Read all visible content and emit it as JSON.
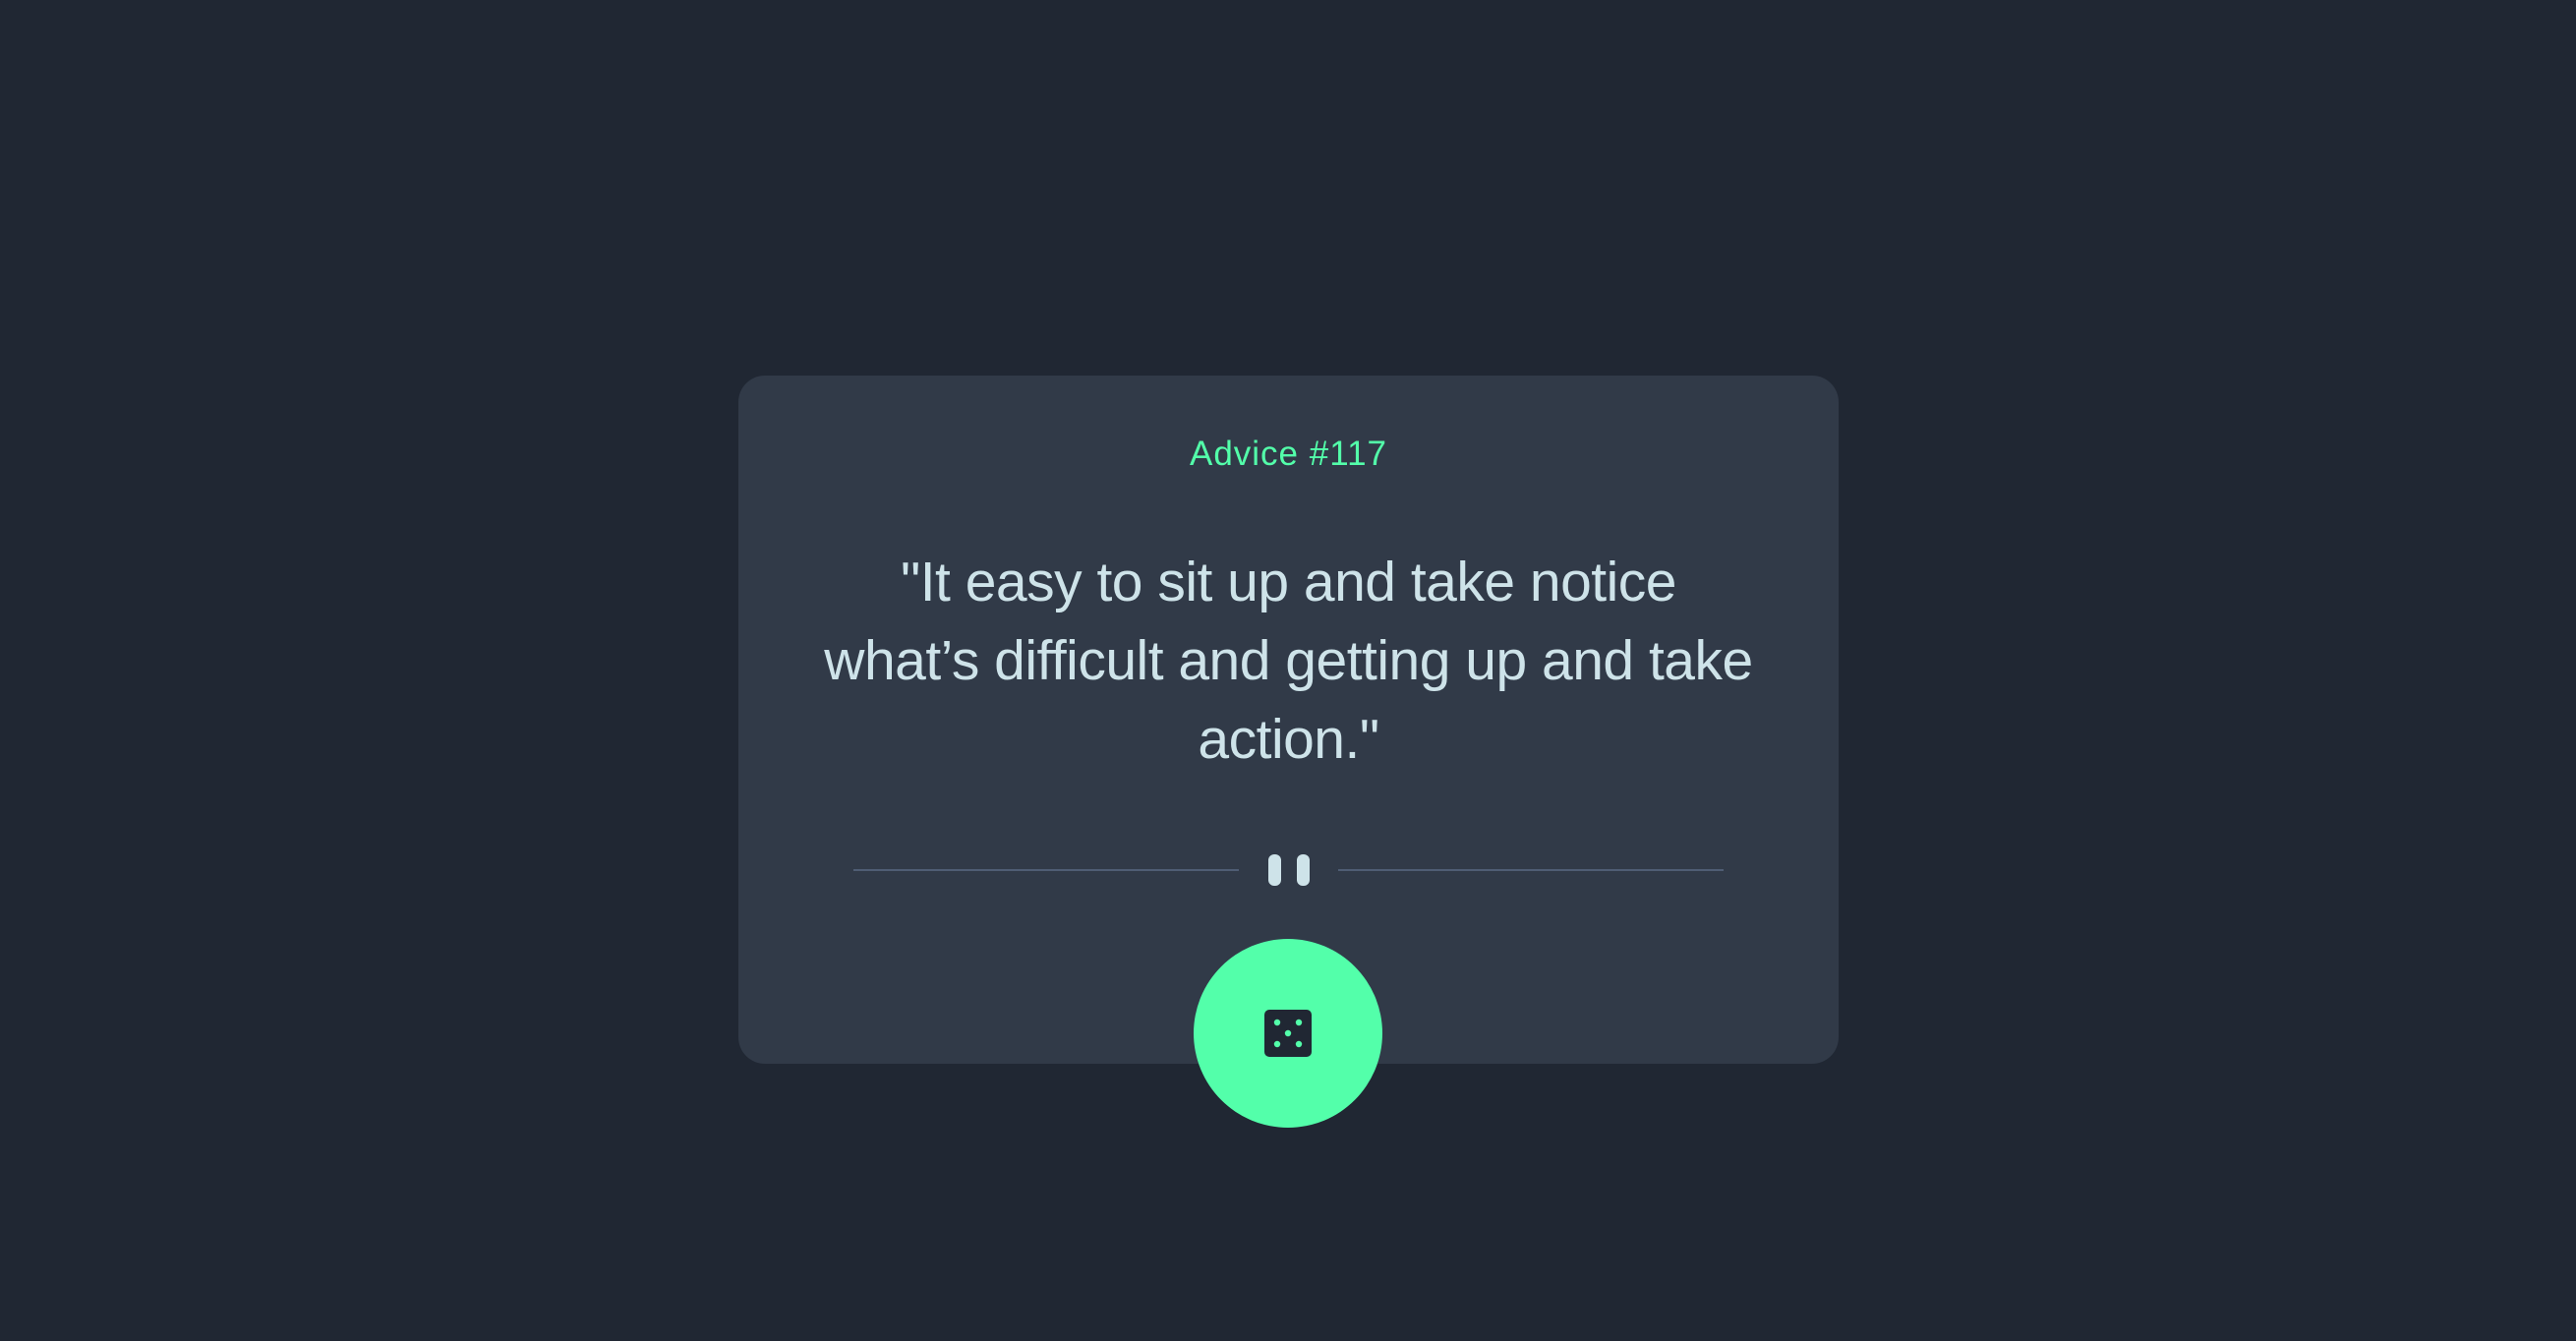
{
  "advice": {
    "label": "Advice #117",
    "text": "\"It easy to sit up and take notice what’s difficult and getting up and take action.\""
  },
  "divider": {
    "icon": "pause-icon"
  },
  "button": {
    "icon": "dice-icon"
  },
  "colors": {
    "background": "#202733",
    "card": "#313A48",
    "accent": "#53FFAA",
    "text": "#CEE3E9",
    "divider": "#4F5D74"
  }
}
